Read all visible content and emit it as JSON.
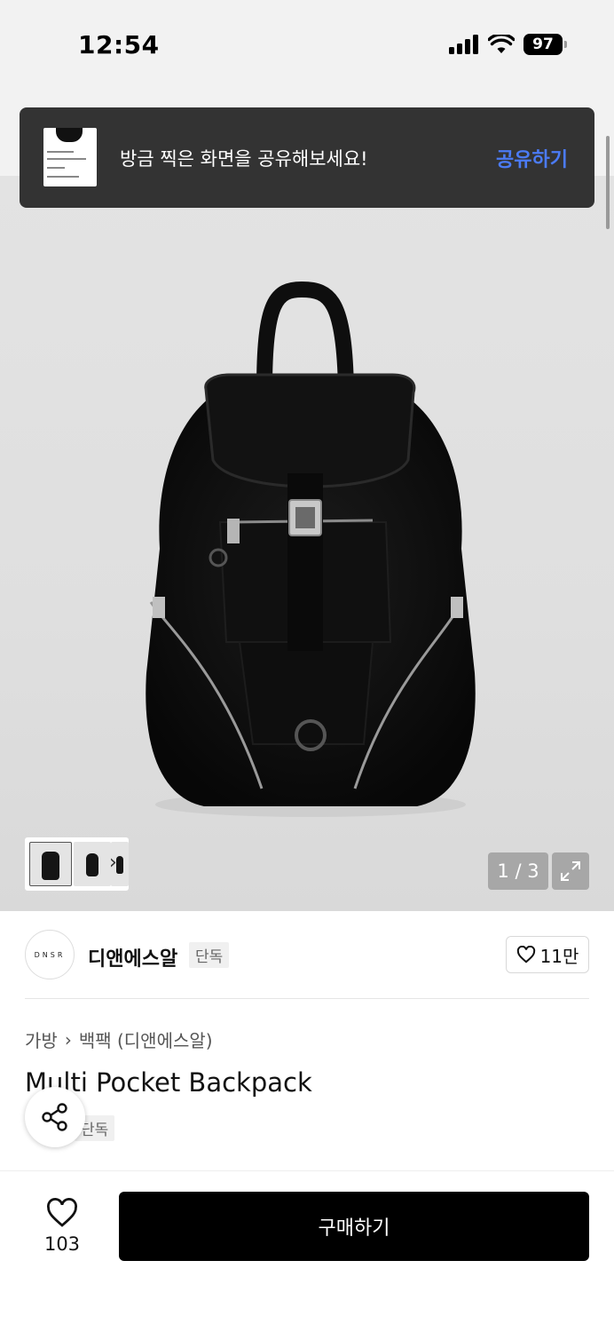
{
  "status_bar": {
    "time": "12:54",
    "battery": "97"
  },
  "toast": {
    "message": "방금 찍은 화면을 공유해보세요!",
    "action_label": "공유하기"
  },
  "gallery": {
    "page_indicator": "1 / 3",
    "current_page": 1,
    "total_pages": 3
  },
  "brand": {
    "logo_text": "DNSR",
    "name": "디앤에스알",
    "tag": "단독",
    "like_count": "11만"
  },
  "breadcrumb": {
    "category": "가방",
    "subcategory": "백팩 (디앤에스알)"
  },
  "product": {
    "title": "Multi Pocket Backpack",
    "tag": "단독"
  },
  "bottom_bar": {
    "wish_count": "103",
    "buy_label": "구매하기"
  }
}
